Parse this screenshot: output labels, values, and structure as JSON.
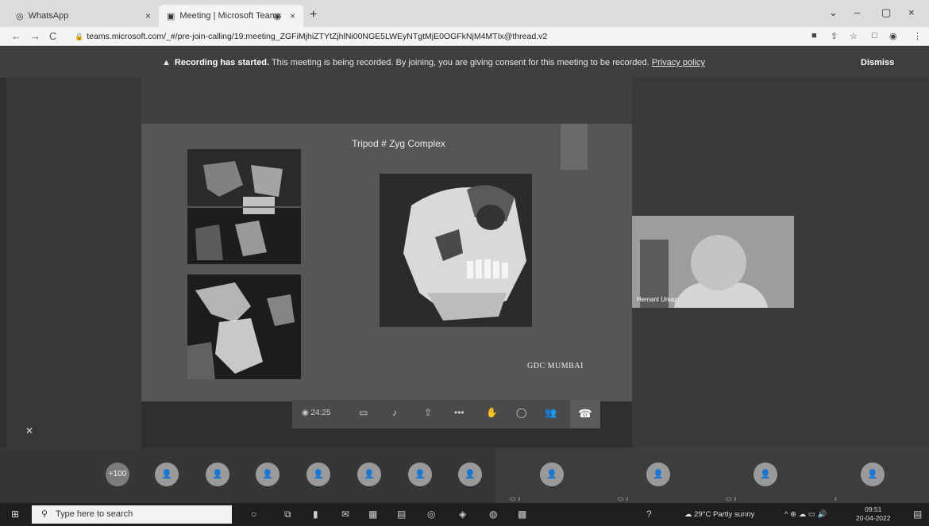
{
  "browser": {
    "tabs": [
      {
        "icon": "whatsapp-icon",
        "glyph": "◎",
        "label": "WhatsApp",
        "close": "×"
      },
      {
        "icon": "teams-icon",
        "glyph": "▣",
        "label": "Meeting | Microsoft Teams",
        "close": "×"
      }
    ],
    "new_tab": "+",
    "window_controls": [
      "⌄",
      "–",
      "▢",
      "×"
    ],
    "nav": [
      "←",
      "→",
      "C"
    ],
    "url": "teams.microsoft.com/_#/pre-join-calling/19:meeting_ZGFiMjhiZTYtZjhlNi00NGE5LWEyNTgtMjE0OGFkNjM4MTIx@thread.v2",
    "extension_glyphs": [
      "■",
      "⇪",
      "☆",
      "□",
      "◉",
      "⋮"
    ]
  },
  "banner": {
    "title": "Recording has started.",
    "message": "This meeting is being recorded. By joining, you are giving consent for this meeting to be recorded.",
    "privacy_link": "Privacy policy",
    "dismiss": "Dismiss",
    "warn_glyph": "▲"
  },
  "slide": {
    "title": "Tripod # Zyg Complex",
    "footer": "GDC MUMBAI"
  },
  "callbar": {
    "timer": "24:25",
    "icons": [
      {
        "name": "camera-icon",
        "glyph": "▭"
      },
      {
        "name": "mic-icon",
        "glyph": "♪"
      },
      {
        "name": "share-icon",
        "glyph": "⇧"
      },
      {
        "name": "more-icon",
        "glyph": "•••"
      },
      {
        "name": "raise-hand-icon",
        "glyph": "✋"
      },
      {
        "name": "chat-icon",
        "glyph": "◯"
      },
      {
        "name": "participants-icon",
        "glyph": "👥"
      }
    ],
    "hangup_glyph": "☎",
    "timer_glyph": "◉"
  },
  "participant": {
    "name": "Hemant Umap"
  },
  "strip": {
    "more_count": "+100",
    "avatar_glyph": "👤",
    "mic_off_glyph": "✕"
  },
  "taskbar": {
    "start_glyph": "⊞",
    "search_placeholder": "Type here to search",
    "search_glyph": "⚲",
    "weather": "29°C  Partly sunny",
    "time": "09:51",
    "date": "20-04-2022",
    "help_glyph": "?",
    "tray_glyphs": "^ ⊕ ☁ ▭ 🔊",
    "notif_glyph": "▤"
  }
}
